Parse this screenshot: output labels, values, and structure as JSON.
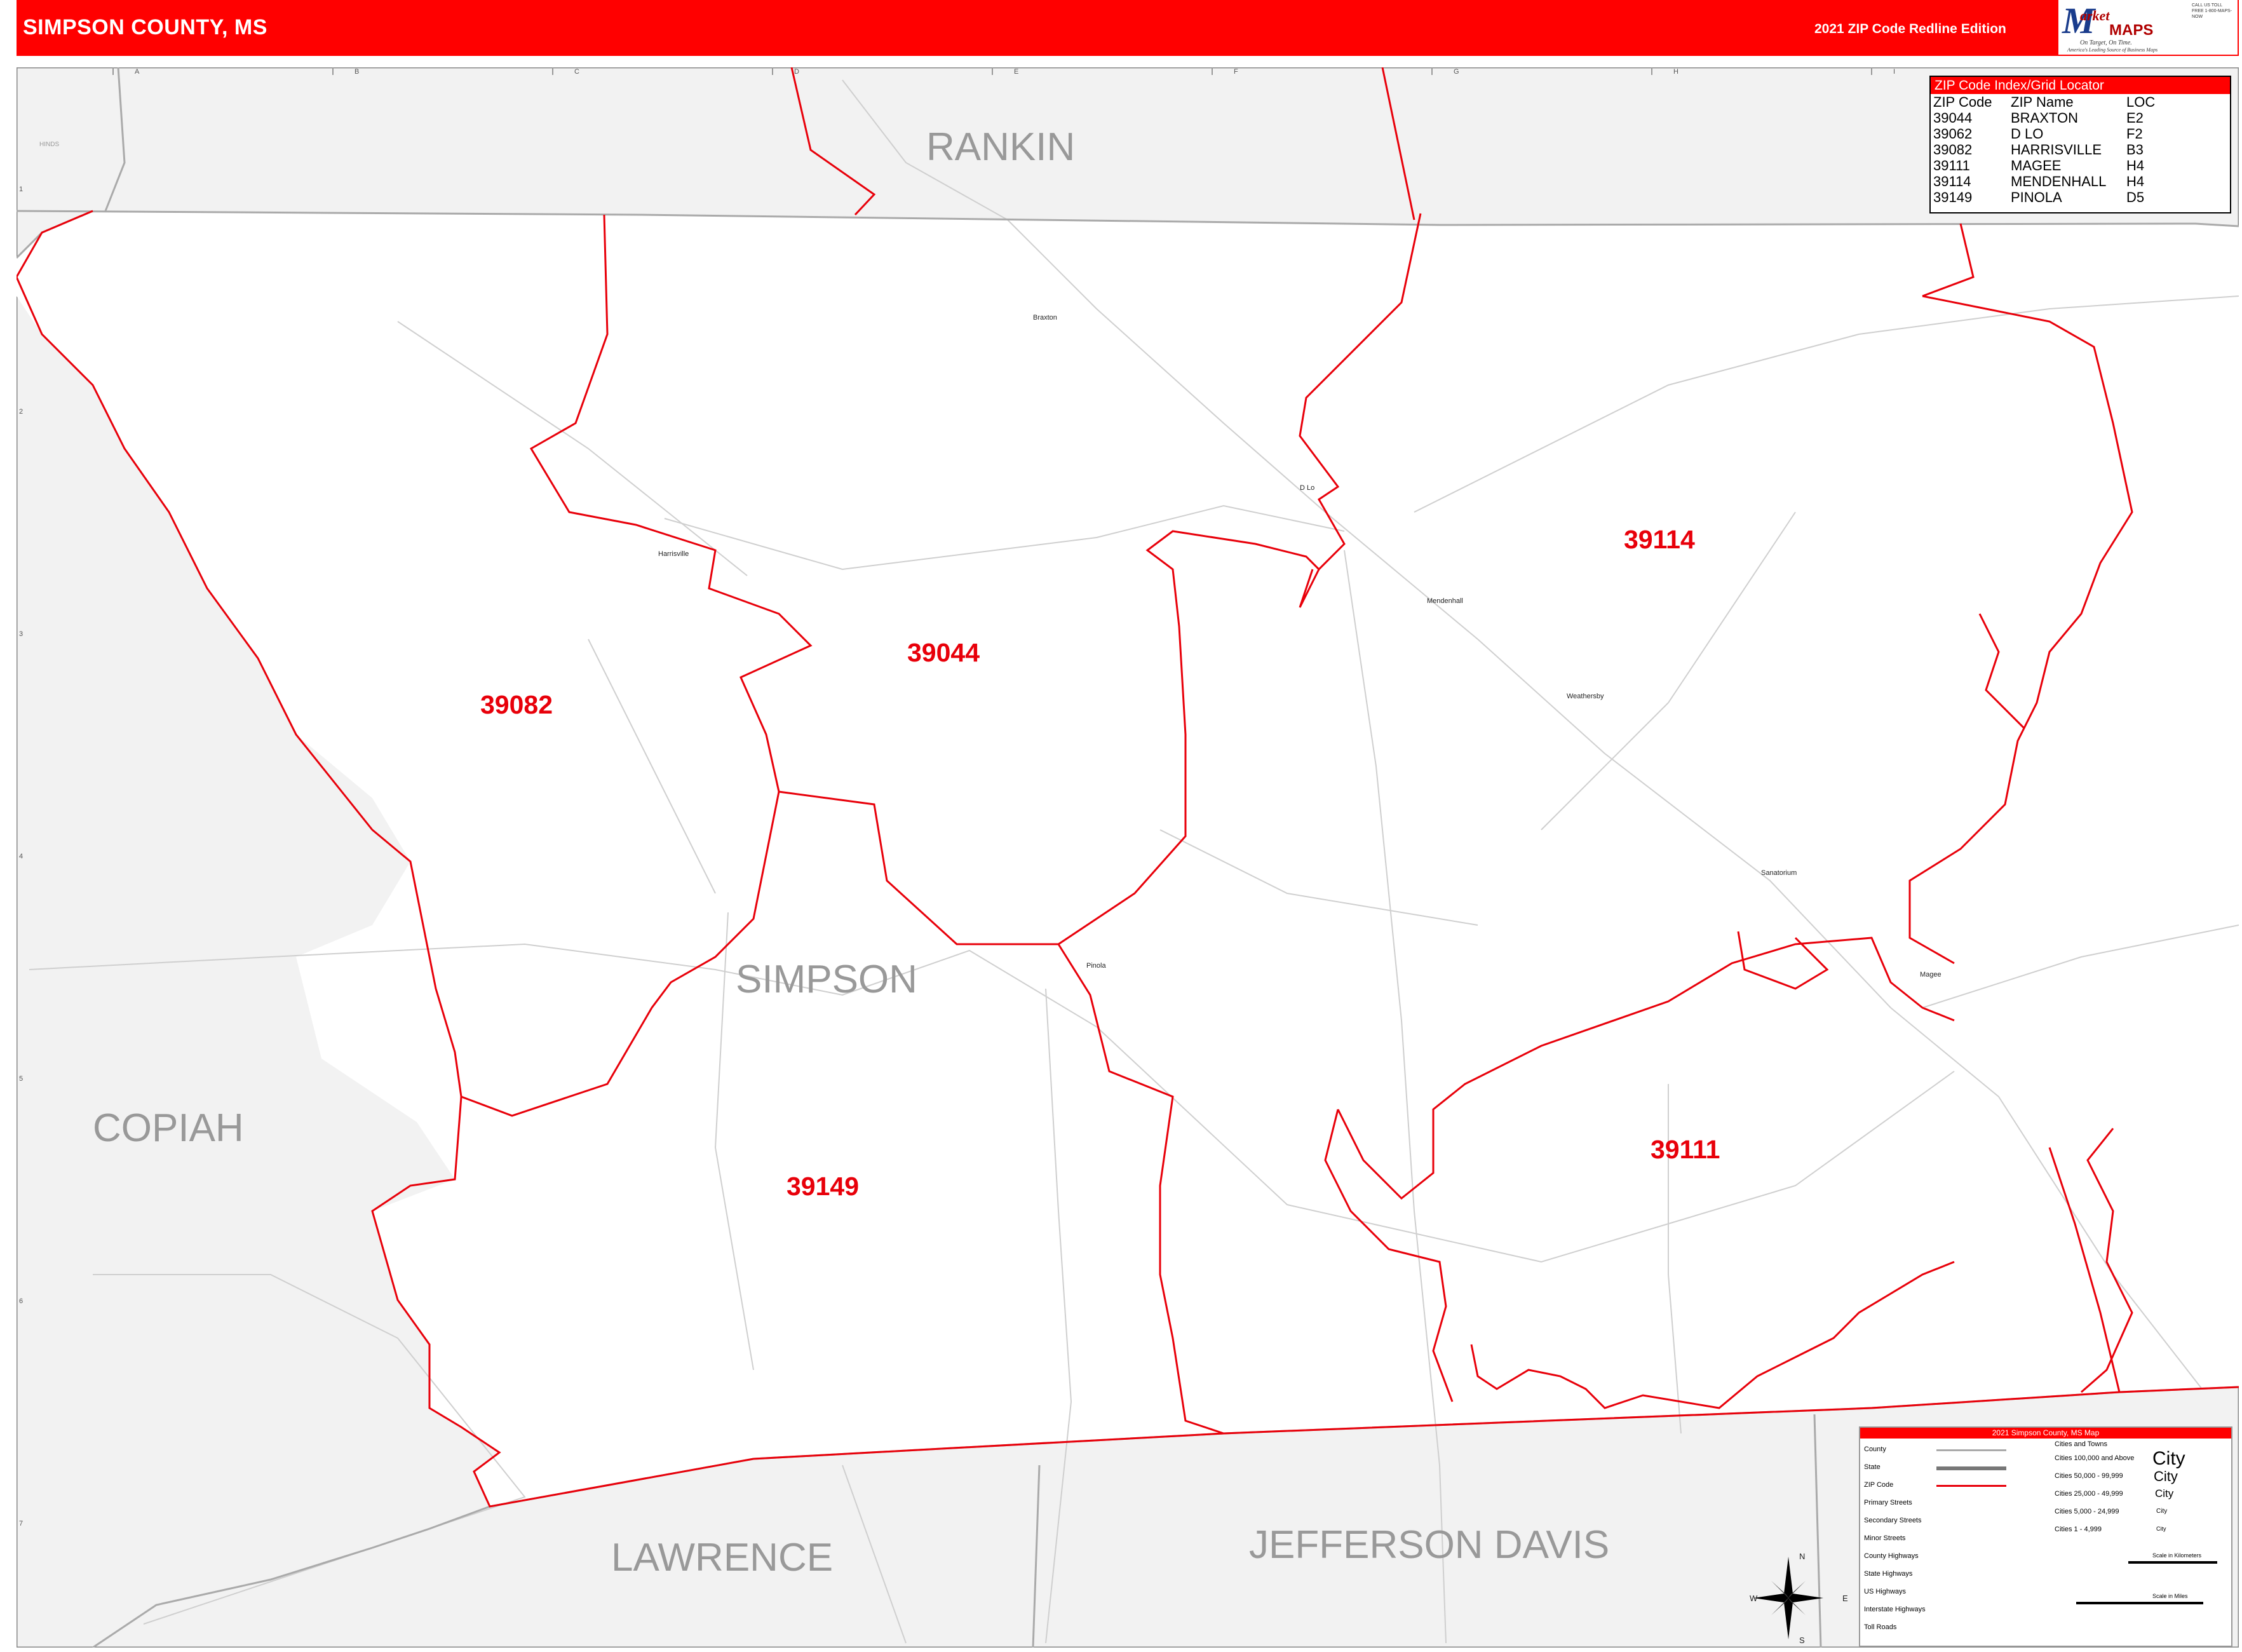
{
  "header": {
    "title": "SIMPSON COUNTY, MS",
    "edition": "2021 ZIP Code Redline Edition",
    "bg_color": "#ff0000"
  },
  "logo": {
    "m": "M",
    "word": "arket",
    "maps": "MAPS",
    "tagline": "On Target, On Time.",
    "tagline2": "America's Leading Source of Business Maps",
    "contact": "CALL US TOLL FREE 1-800-MAPS-NOW"
  },
  "map": {
    "counties": {
      "rankin": "RANKIN",
      "simpson": "SIMPSON",
      "copiah": "COPIAH",
      "lawrence": "LAWRENCE",
      "jefferson_davis": "JEFFERSON DAVIS",
      "hinds": "HINDS"
    },
    "zips": [
      "39082",
      "39044",
      "39114",
      "39149",
      "39111"
    ],
    "towns": {
      "braxton": "Braxton",
      "harrisville": "Harrisville",
      "mendenhall": "Mendenhall",
      "d_lo": "D Lo",
      "weathersby": "Weathersby",
      "sanatorium": "Sanatorium",
      "magee": "Magee",
      "pinola": "Pinola"
    },
    "grid_cols": [
      "A",
      "B",
      "C",
      "D",
      "E",
      "F",
      "G",
      "H",
      "I"
    ],
    "grid_rows": [
      "1",
      "2",
      "3",
      "4",
      "5",
      "6",
      "7"
    ],
    "colors": {
      "zip_boundary": "#e8000a",
      "outside_county": "#f2f2f2",
      "roads": "#c8c8c8"
    }
  },
  "index": {
    "title": "ZIP Code Index/Grid Locator",
    "headers": [
      "ZIP Code",
      "ZIP Name",
      "LOC"
    ],
    "rows": [
      [
        "39044",
        "BRAXTON",
        "E2"
      ],
      [
        "39062",
        "D LO",
        "F2"
      ],
      [
        "39082",
        "HARRISVILLE",
        "B3"
      ],
      [
        "39111",
        "MAGEE",
        "H4"
      ],
      [
        "39114",
        "MENDENHALL",
        "H4"
      ],
      [
        "39149",
        "PINOLA",
        "D5"
      ]
    ]
  },
  "legend": {
    "title": "2021 Simpson County, MS Map",
    "items": [
      "County",
      "State",
      "ZIP Code",
      "Primary Streets",
      "Secondary Streets",
      "Minor Streets",
      "County Highways",
      "State Highways",
      "US Highways",
      "Interstate Highways",
      "Toll Roads"
    ],
    "cities_title": "Cities and Towns",
    "city_classes": [
      {
        "range": "Cities 100,000 and Above",
        "label": "City"
      },
      {
        "range": "Cities 50,000 - 99,999",
        "label": "City"
      },
      {
        "range": "Cities 25,000 - 49,999",
        "label": "City"
      },
      {
        "range": "Cities 5,000 - 24,999",
        "label": "City"
      },
      {
        "range": "Cities 1 - 4,999",
        "label": "City"
      }
    ],
    "scale_km": "Scale in Kilometers",
    "scale_mi": "Scale in Miles",
    "compass": {
      "n": "N",
      "s": "S",
      "e": "E",
      "w": "W"
    }
  }
}
